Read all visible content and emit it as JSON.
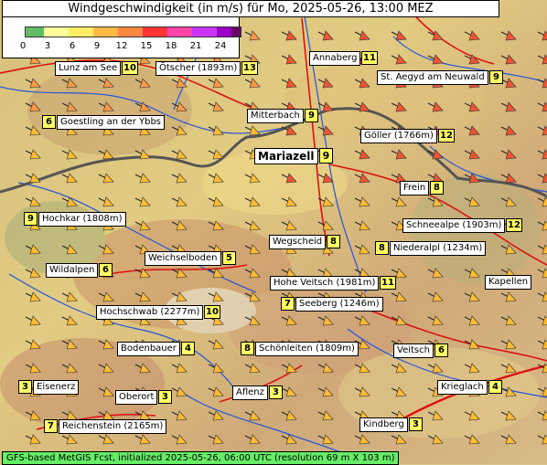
{
  "title": "Windgeschwindigkeit (in m/s) für Mo, 2025-05-26, 13:00 MEZ",
  "legend": {
    "ticks": [
      "0",
      "3",
      "6",
      "9",
      "12",
      "15",
      "18",
      "21",
      "24"
    ],
    "colors": [
      "#66bb66",
      "#ffff99",
      "#ffee66",
      "#ffbb44",
      "#ff8844",
      "#ff3333",
      "#ff44aa",
      "#cc33ff",
      "#9900cc",
      "#660066"
    ]
  },
  "locations": [
    {
      "name": "Lunz am See",
      "value": "10"
    },
    {
      "name": "Ötscher (1893m)",
      "value": "13"
    },
    {
      "name": "Annaberg",
      "value": "11"
    },
    {
      "name": "St. Aegyd am Neuwald",
      "value": "9"
    },
    {
      "name": "Goestling an der Ybbs",
      "value": "6"
    },
    {
      "name": "Mitterbach",
      "value": "9"
    },
    {
      "name": "Göller (1766m)",
      "value": "12"
    },
    {
      "name": "Mariazell",
      "value": "9"
    },
    {
      "name": "Frein",
      "value": "8"
    },
    {
      "name": "Hochkar (1808m)",
      "value": "9"
    },
    {
      "name": "Schneealpe (1903m)",
      "value": "12"
    },
    {
      "name": "Wegscheid",
      "value": "8"
    },
    {
      "name": "Niederalpl (1234m)",
      "value": "8"
    },
    {
      "name": "Weichselboden",
      "value": "5"
    },
    {
      "name": "Wildalpen",
      "value": "6"
    },
    {
      "name": "Hohe Veitsch (1981m)",
      "value": "11"
    },
    {
      "name": "Kapellen",
      "value": ""
    },
    {
      "name": "Seeberg (1246m)",
      "value": "7"
    },
    {
      "name": "Hochschwab (2277m)",
      "value": "10"
    },
    {
      "name": "Bodenbauer",
      "value": "4"
    },
    {
      "name": "Schönleiten (1809m)",
      "value": "8"
    },
    {
      "name": "Veitsch",
      "value": "6"
    },
    {
      "name": "Eisenerz",
      "value": "3"
    },
    {
      "name": "Oberort",
      "value": "3"
    },
    {
      "name": "Aflenz",
      "value": "3"
    },
    {
      "name": "Krieglach",
      "value": "4"
    },
    {
      "name": "Reichenstein (2165m)",
      "value": "7"
    },
    {
      "name": "Kindberg",
      "value": "3"
    }
  ],
  "footer": "GFS-based MetGIS Fcst, initialized 2025-05-26, 06:00 UTC  (resolution 69 m X 103 m)"
}
